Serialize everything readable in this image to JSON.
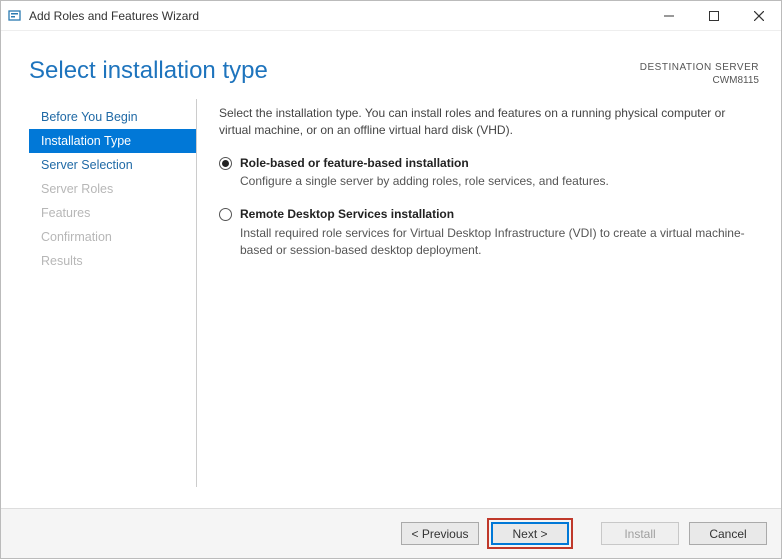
{
  "window": {
    "title": "Add Roles and Features Wizard"
  },
  "header": {
    "title": "Select installation type",
    "dest_label": "DESTINATION SERVER",
    "dest_value": "CWM8115"
  },
  "nav": {
    "items": [
      {
        "label": "Before You Begin",
        "state": "enabled"
      },
      {
        "label": "Installation Type",
        "state": "active"
      },
      {
        "label": "Server Selection",
        "state": "enabled"
      },
      {
        "label": "Server Roles",
        "state": "disabled"
      },
      {
        "label": "Features",
        "state": "disabled"
      },
      {
        "label": "Confirmation",
        "state": "disabled"
      },
      {
        "label": "Results",
        "state": "disabled"
      }
    ]
  },
  "content": {
    "intro": "Select the installation type. You can install roles and features on a running physical computer or virtual machine, or on an offline virtual hard disk (VHD).",
    "options": [
      {
        "title": "Role-based or feature-based installation",
        "desc": "Configure a single server by adding roles, role services, and features.",
        "selected": true
      },
      {
        "title": "Remote Desktop Services installation",
        "desc": "Install required role services for Virtual Desktop Infrastructure (VDI) to create a virtual machine-based or session-based desktop deployment.",
        "selected": false
      }
    ]
  },
  "footer": {
    "previous": "< Previous",
    "next": "Next >",
    "install": "Install",
    "cancel": "Cancel"
  }
}
